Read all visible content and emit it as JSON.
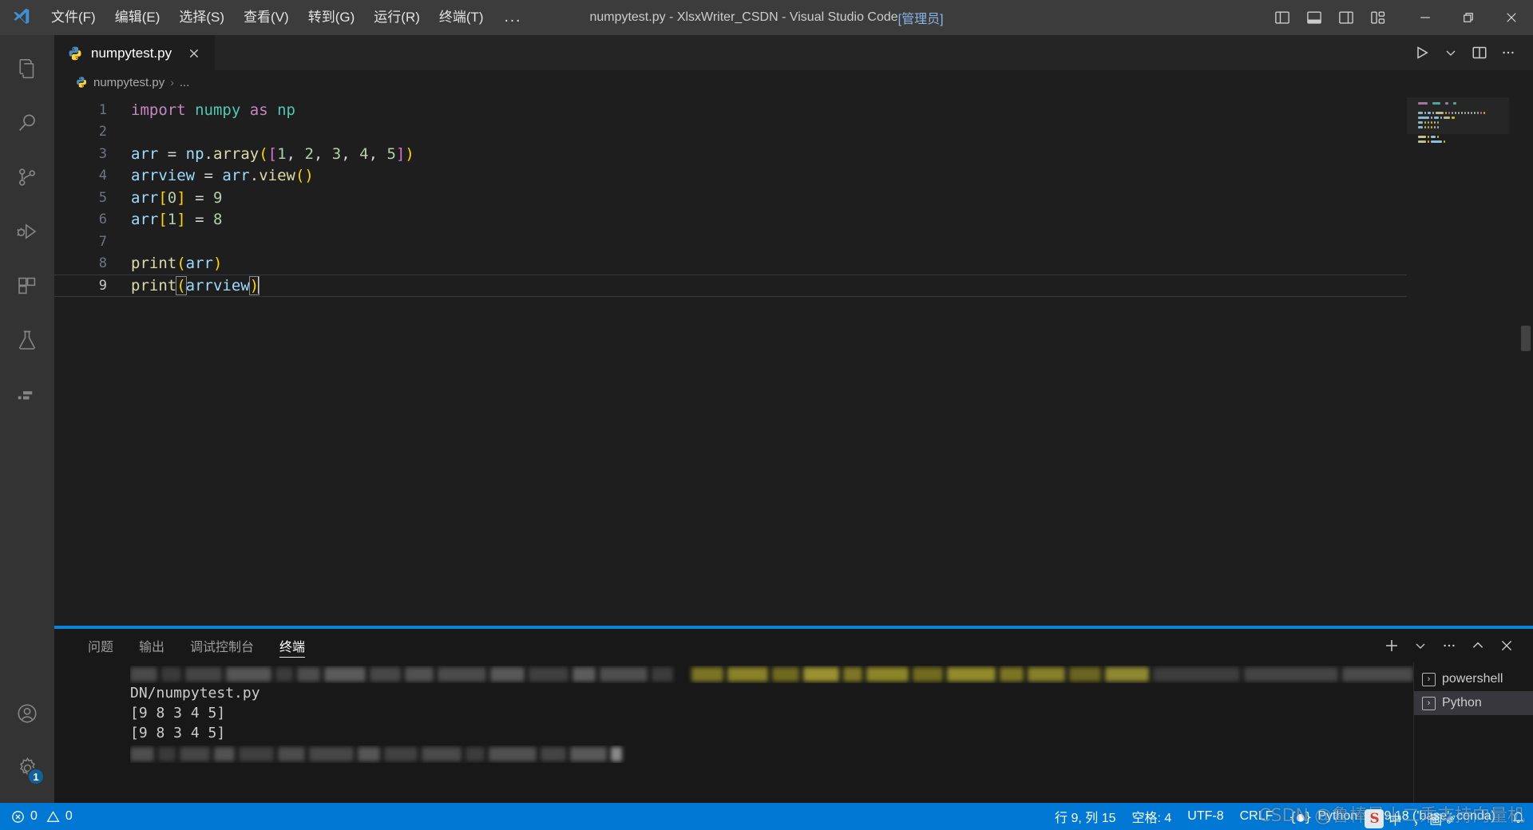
{
  "titlebar": {
    "logo_icon": "vscode-logo-icon",
    "menus": [
      {
        "label": "文件(F)",
        "name": "menu-file"
      },
      {
        "label": "编辑(E)",
        "name": "menu-edit"
      },
      {
        "label": "选择(S)",
        "name": "menu-selection"
      },
      {
        "label": "查看(V)",
        "name": "menu-view"
      },
      {
        "label": "转到(G)",
        "name": "menu-go"
      },
      {
        "label": "运行(R)",
        "name": "menu-run"
      },
      {
        "label": "终端(T)",
        "name": "menu-terminal"
      }
    ],
    "more_label": "...",
    "title": "numpytest.py - XlsxWriter_CSDN - Visual Studio Code ",
    "title_admin": "[管理员]",
    "layout_buttons": [
      {
        "name": "toggle-primary-sidebar-icon",
        "tooltip": "切换主侧栏"
      },
      {
        "name": "toggle-panel-icon",
        "tooltip": "切换面板"
      },
      {
        "name": "toggle-secondary-sidebar-icon",
        "tooltip": "切换辅助侧栏"
      },
      {
        "name": "customize-layout-icon",
        "tooltip": "自定义布局"
      }
    ],
    "window_controls": [
      {
        "name": "minimize-button",
        "glyph": "—"
      },
      {
        "name": "restore-button",
        "glyph": "❐"
      },
      {
        "name": "close-button",
        "glyph": "✕"
      }
    ]
  },
  "activitybar": {
    "items": [
      {
        "name": "activity-explorer",
        "icon": "files-icon",
        "label": "资源管理器"
      },
      {
        "name": "activity-search",
        "icon": "search-icon",
        "label": "搜索"
      },
      {
        "name": "activity-source-control",
        "icon": "source-control-icon",
        "label": "源代码管理"
      },
      {
        "name": "activity-run-debug",
        "icon": "run-and-debug-icon",
        "label": "运行和调试"
      },
      {
        "name": "activity-extensions",
        "icon": "extensions-icon",
        "label": "扩展"
      },
      {
        "name": "activity-testing",
        "icon": "beaker-icon",
        "label": "测试"
      },
      {
        "name": "activity-custom",
        "icon": "remote-explorer-icon",
        "label": "自定义视图"
      }
    ],
    "bottom": [
      {
        "name": "activity-accounts",
        "icon": "account-icon",
        "label": "账户"
      },
      {
        "name": "activity-settings",
        "icon": "gear-icon",
        "label": "管理",
        "badge": "1"
      }
    ]
  },
  "tabs": {
    "open": [
      {
        "name": "tab-numpytest-py",
        "label": "numpytest.py",
        "icon": "python-file-icon",
        "active": true,
        "close_glyph": "✕"
      }
    ],
    "actions": [
      {
        "name": "run-python-file-button",
        "icon": "play-icon"
      },
      {
        "name": "run-options-dropdown",
        "icon": "chevron-down-icon"
      },
      {
        "name": "split-editor-button",
        "icon": "split-editor-icon"
      },
      {
        "name": "more-actions-button",
        "icon": "ellipsis-icon"
      }
    ]
  },
  "breadcrumb": {
    "icon": "python-file-icon",
    "file": "numpytest.py",
    "separator": "›",
    "tail": "..."
  },
  "editor": {
    "language": "python",
    "lines": [
      {
        "n": "1",
        "tokens": [
          {
            "t": "import",
            "c": "t-kw"
          },
          {
            "t": " ",
            "c": "t-op"
          },
          {
            "t": "numpy",
            "c": "t-mod"
          },
          {
            "t": " ",
            "c": "t-op"
          },
          {
            "t": "as",
            "c": "t-kw"
          },
          {
            "t": " ",
            "c": "t-op"
          },
          {
            "t": "np",
            "c": "t-mod"
          }
        ]
      },
      {
        "n": "2",
        "tokens": []
      },
      {
        "n": "3",
        "tokens": [
          {
            "t": "arr",
            "c": "t-var"
          },
          {
            "t": " = ",
            "c": "t-op"
          },
          {
            "t": "np",
            "c": "t-var"
          },
          {
            "t": ".",
            "c": "t-punc"
          },
          {
            "t": "array",
            "c": "t-fn"
          },
          {
            "t": "(",
            "c": "br-y"
          },
          {
            "t": "[",
            "c": "br-p"
          },
          {
            "t": "1",
            "c": "t-num"
          },
          {
            "t": ", ",
            "c": "t-punc"
          },
          {
            "t": "2",
            "c": "t-num"
          },
          {
            "t": ", ",
            "c": "t-punc"
          },
          {
            "t": "3",
            "c": "t-num"
          },
          {
            "t": ", ",
            "c": "t-punc"
          },
          {
            "t": "4",
            "c": "t-num"
          },
          {
            "t": ", ",
            "c": "t-punc"
          },
          {
            "t": "5",
            "c": "t-num"
          },
          {
            "t": "]",
            "c": "br-p"
          },
          {
            "t": ")",
            "c": "br-y"
          }
        ]
      },
      {
        "n": "4",
        "tokens": [
          {
            "t": "arrview",
            "c": "t-var"
          },
          {
            "t": " = ",
            "c": "t-op"
          },
          {
            "t": "arr",
            "c": "t-var"
          },
          {
            "t": ".",
            "c": "t-punc"
          },
          {
            "t": "view",
            "c": "t-fn"
          },
          {
            "t": "()",
            "c": "br-y"
          }
        ]
      },
      {
        "n": "5",
        "tokens": [
          {
            "t": "arr",
            "c": "t-var"
          },
          {
            "t": "[",
            "c": "br-y"
          },
          {
            "t": "0",
            "c": "t-num"
          },
          {
            "t": "]",
            "c": "br-y"
          },
          {
            "t": " = ",
            "c": "t-op"
          },
          {
            "t": "9",
            "c": "t-num"
          }
        ]
      },
      {
        "n": "6",
        "tokens": [
          {
            "t": "arr",
            "c": "t-var"
          },
          {
            "t": "[",
            "c": "br-y"
          },
          {
            "t": "1",
            "c": "t-num"
          },
          {
            "t": "]",
            "c": "br-y"
          },
          {
            "t": " = ",
            "c": "t-op"
          },
          {
            "t": "8",
            "c": "t-num"
          }
        ]
      },
      {
        "n": "7",
        "tokens": []
      },
      {
        "n": "8",
        "tokens": [
          {
            "t": "print",
            "c": "t-fn"
          },
          {
            "t": "(",
            "c": "br-y"
          },
          {
            "t": "arr",
            "c": "t-var"
          },
          {
            "t": ")",
            "c": "br-y"
          }
        ]
      },
      {
        "n": "9",
        "current": true,
        "tokens": [
          {
            "t": "print",
            "c": "t-fn"
          },
          {
            "t": "(",
            "c": "br-y brmatch"
          },
          {
            "t": "arrview",
            "c": "t-var"
          },
          {
            "t": ")",
            "c": "br-y brmatch"
          }
        ]
      }
    ]
  },
  "panel": {
    "tabs": [
      {
        "name": "panel-tab-problems",
        "label": "问题",
        "active": false
      },
      {
        "name": "panel-tab-output",
        "label": "输出",
        "active": false
      },
      {
        "name": "panel-tab-debug-console",
        "label": "调试控制台",
        "active": false
      },
      {
        "name": "panel-tab-terminal",
        "label": "终端",
        "active": true
      }
    ],
    "actions": [
      {
        "name": "new-terminal-button",
        "icon": "plus-icon"
      },
      {
        "name": "terminal-profile-dropdown",
        "icon": "chevron-down-icon"
      },
      {
        "name": "panel-more-actions-button",
        "icon": "ellipsis-icon"
      },
      {
        "name": "maximize-panel-button",
        "icon": "chevron-up-icon"
      },
      {
        "name": "close-panel-button",
        "icon": "close-icon"
      }
    ],
    "terminal_output": [
      "DN/numpytest.py",
      "[9 8 3 4 5]",
      "[9 8 3 4 5]"
    ],
    "terminal_list": [
      {
        "name": "terminal-entry-powershell",
        "label": "powershell",
        "icon": "terminal-icon",
        "active": false
      },
      {
        "name": "terminal-entry-python",
        "label": "Python",
        "icon": "terminal-icon",
        "active": true
      }
    ]
  },
  "statusbar": {
    "errors_icon": "error-icon",
    "errors": "0",
    "warnings_icon": "warning-icon",
    "warnings": "0",
    "cursor_position": "行 9, 列 15",
    "indentation": "空格: 4",
    "encoding": "UTF-8",
    "eol": "CRLF",
    "language_icon": "python-braces-icon",
    "language": "Python",
    "interpreter": "3.9.18 ('base': conda)",
    "bell_icon": "bell-icon",
    "accent_color": "#0078d4"
  },
  "watermark": {
    "text": "CSDN @鲁棒最小二乘支持向量机"
  },
  "ime": {
    "logo": "S",
    "text": "中 ˙ ， 画 ✐"
  },
  "colors": {
    "titlebar_bg": "#3c3c3c",
    "activitybar_bg": "#333333",
    "editor_bg": "#1e1e1e",
    "tabs_bg": "#252526",
    "panel_bg": "#181818",
    "status_bg": "#0078d4",
    "panel_top_border": "#0a84d8"
  }
}
